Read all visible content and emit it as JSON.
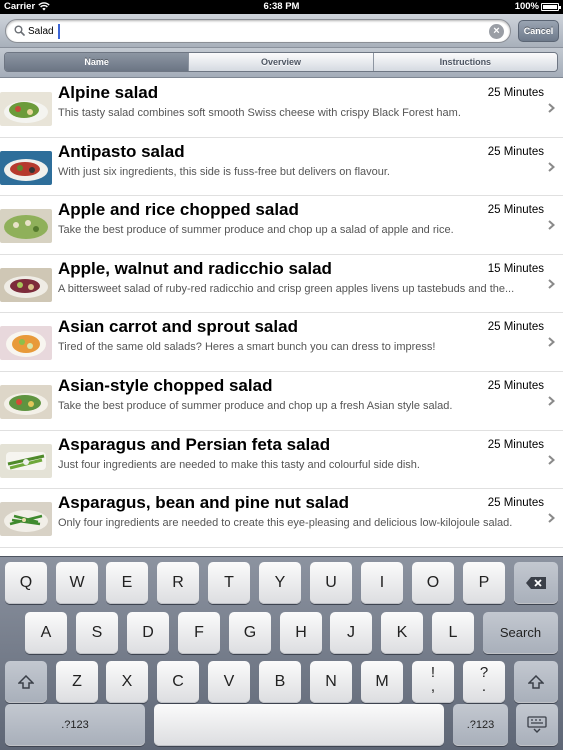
{
  "status_bar": {
    "carrier": "Carrier",
    "time": "6:38 PM",
    "battery": "100%"
  },
  "search": {
    "value": "Salad",
    "cancel_label": "Cancel"
  },
  "segments": [
    {
      "label": "Name",
      "selected": true
    },
    {
      "label": "Overview",
      "selected": false
    },
    {
      "label": "Instructions",
      "selected": false
    }
  ],
  "recipes": [
    {
      "title": "Alpine salad",
      "time": "25 Minutes",
      "description": "This tasty salad combines soft smooth Swiss cheese with crispy Black Forest ham."
    },
    {
      "title": "Antipasto salad",
      "time": "25 Minutes",
      "description": "With just six ingredients, this side is fuss-free but delivers on flavour."
    },
    {
      "title": "Apple and rice chopped salad",
      "time": "25 Minutes",
      "description": "Take the best produce of summer produce and chop up a salad of apple and rice."
    },
    {
      "title": "Apple, walnut and radicchio salad",
      "time": "15 Minutes",
      "description": "A bittersweet salad of ruby-red radicchio and crisp green apples livens up tastebuds and the..."
    },
    {
      "title": "Asian carrot and sprout salad",
      "time": "25 Minutes",
      "description": "Tired of the same old salads? Heres a smart bunch you can dress to impress!"
    },
    {
      "title": "Asian-style chopped salad",
      "time": "25 Minutes",
      "description": "Take the best produce of summer produce and chop up a fresh Asian style salad."
    },
    {
      "title": "Asparagus and Persian feta salad",
      "time": "25 Minutes",
      "description": "Just four ingredients are needed to make this tasty and colourful side dish."
    },
    {
      "title": "Asparagus, bean and pine nut salad",
      "time": "25 Minutes",
      "description": "Only four ingredients are needed to create this eye-pleasing and delicious low-kilojoule salad."
    }
  ],
  "keyboard": {
    "row1": [
      "Q",
      "W",
      "E",
      "R",
      "T",
      "Y",
      "U",
      "I",
      "O",
      "P"
    ],
    "row2": [
      "A",
      "S",
      "D",
      "F",
      "G",
      "H",
      "J",
      "K",
      "L"
    ],
    "row3": [
      "Z",
      "X",
      "C",
      "V",
      "B",
      "N",
      "M"
    ],
    "search_label": "Search",
    "numbers_label": ".?123",
    "punct_1": "!,",
    "punct_2": "?."
  }
}
